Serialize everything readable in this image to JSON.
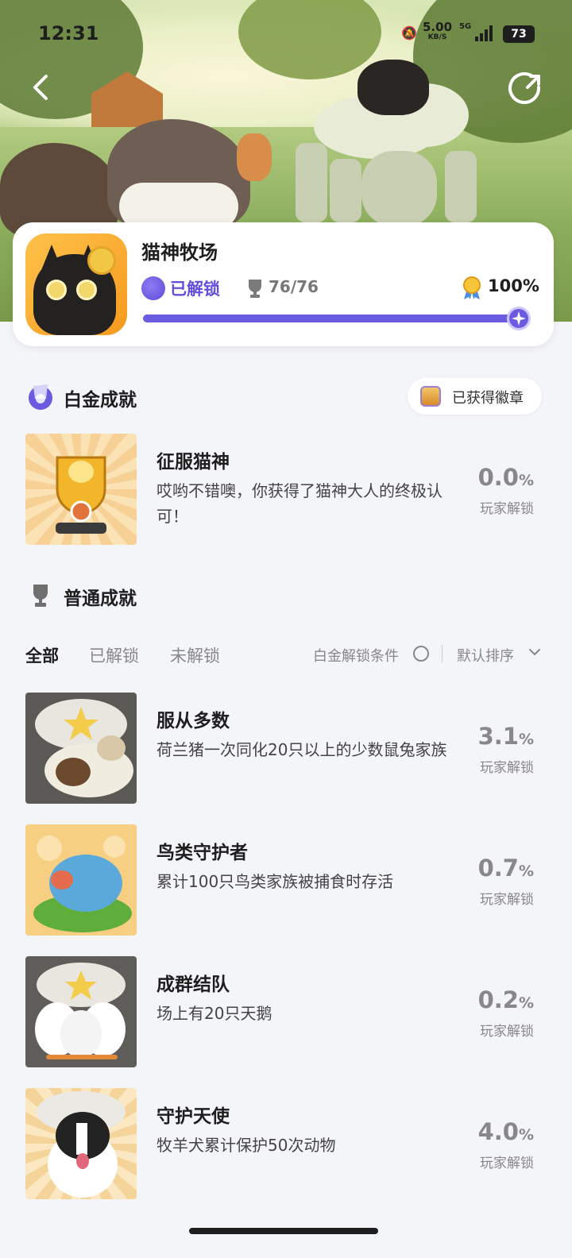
{
  "status_bar": {
    "time": "12:31",
    "speed": "5.00",
    "speed_unit": "KB/S",
    "network": "5G",
    "battery": "73"
  },
  "game": {
    "title": "猫神牧场",
    "unlock_status": "已解锁",
    "trophy_count": "76/76",
    "completion": "100%",
    "progress_fraction": 1.0
  },
  "platinum": {
    "title": "白金成就",
    "badge_label": "已获得徽章",
    "achievement": {
      "name": "征服猫神",
      "description": "哎哟不错噢，你获得了猫神大人的终极认可！",
      "rate": "0.0",
      "rate_unit": "%",
      "rate_label": "玩家解锁"
    }
  },
  "normal": {
    "title": "普通成就",
    "filters": [
      "全部",
      "已解锁",
      "未解锁"
    ],
    "condition_label": "白金解锁条件",
    "sort_label": "默认排序",
    "achievements": [
      {
        "name": "服从多数",
        "description": "荷兰猪一次同化20只以上的少数鼠兔家族",
        "rate": "3.1",
        "rate_unit": "%",
        "rate_label": "玩家解锁"
      },
      {
        "name": "鸟类守护者",
        "description": "累计100只鸟类家族被捕食时存活",
        "rate": "0.7",
        "rate_unit": "%",
        "rate_label": "玩家解锁"
      },
      {
        "name": "成群结队",
        "description": "场上有20只天鹅",
        "rate": "0.2",
        "rate_unit": "%",
        "rate_label": "玩家解锁"
      },
      {
        "name": "守护天使",
        "description": "牧羊犬累计保护50次动物",
        "rate": "4.0",
        "rate_unit": "%",
        "rate_label": "玩家解锁"
      }
    ]
  },
  "colors": {
    "accent": "#6b5be0",
    "accent_text": "#6150dd",
    "background": "#f4f5f9",
    "muted": "#888888"
  }
}
